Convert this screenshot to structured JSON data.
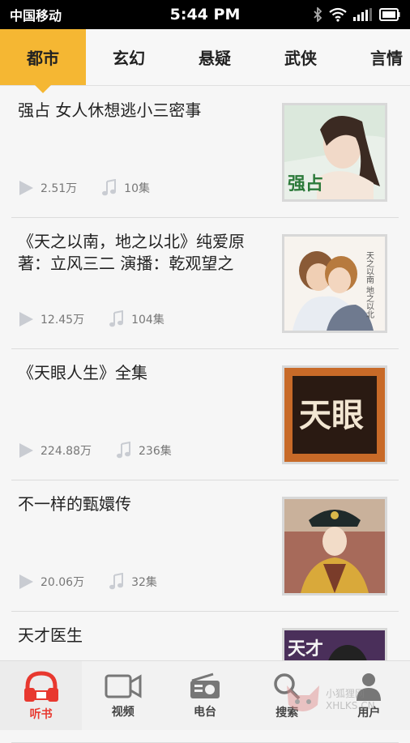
{
  "status_bar": {
    "carrier": "中国移动",
    "time": "5:44 PM"
  },
  "tabs": [
    {
      "label": "都市",
      "active": true
    },
    {
      "label": "玄幻",
      "active": false
    },
    {
      "label": "悬疑",
      "active": false
    },
    {
      "label": "武侠",
      "active": false
    },
    {
      "label": "言情",
      "active": false
    }
  ],
  "items": [
    {
      "title": "强占 女人休想逃小三密事",
      "plays": "2.51万",
      "episodes": "10集",
      "cover_text": "强占"
    },
    {
      "title": "《天之以南，地之以北》纯爱原著：立风三二 演播：乾观望之",
      "plays": "12.45万",
      "episodes": "104集",
      "cover_text": "天之以南 地之以北"
    },
    {
      "title": "《天眼人生》全集",
      "plays": "224.88万",
      "episodes": "236集",
      "cover_text": "天眼"
    },
    {
      "title": "不一样的甄嬛传",
      "plays": "20.06万",
      "episodes": "32集",
      "cover_text": ""
    },
    {
      "title": "天才医生",
      "plays": "",
      "episodes": "",
      "cover_text": "天才"
    }
  ],
  "bottom_nav": [
    {
      "label": "听书",
      "icon": "headphones-icon",
      "active": true
    },
    {
      "label": "视频",
      "icon": "video-camera-icon",
      "active": false
    },
    {
      "label": "电台",
      "icon": "radio-icon",
      "active": false
    },
    {
      "label": "搜索",
      "icon": "search-icon",
      "active": false
    },
    {
      "label": "用户",
      "icon": "user-icon",
      "active": false
    }
  ],
  "watermark": {
    "text1": "小狐狸网",
    "text2": "XHLKS.CN"
  },
  "colors": {
    "accent": "#f5b733",
    "active_nav": "#e8382f"
  }
}
